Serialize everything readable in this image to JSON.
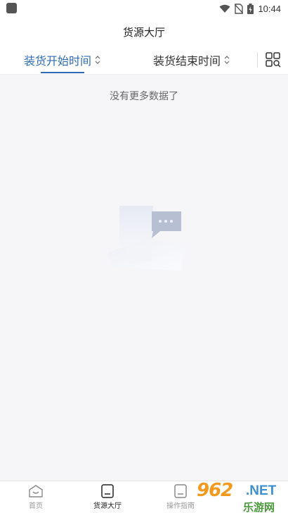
{
  "status_bar": {
    "time": "10:44",
    "icons": [
      "wifi-icon",
      "no-sim-icon",
      "battery-icon"
    ]
  },
  "header": {
    "title": "货源大厅"
  },
  "filters": {
    "tabs": [
      {
        "label": "装货开始时间",
        "active": true,
        "icon": "sort-icon"
      },
      {
        "label": "装货结束时间",
        "active": false,
        "icon": "sort-icon"
      }
    ],
    "layout_icon": "grid-search-icon"
  },
  "content": {
    "empty_message": "没有更多数据了",
    "illustration": "empty-message-icon"
  },
  "bottom_nav": {
    "items": [
      {
        "label": "首页",
        "icon": "home-icon",
        "active": false
      },
      {
        "label": "货源大厅",
        "icon": "document-icon",
        "active": true
      },
      {
        "label": "操作指南",
        "icon": "guide-icon",
        "active": false
      }
    ]
  },
  "watermark": {
    "digits": "962",
    "suffix": ".NET",
    "subtitle": "乐游网"
  },
  "colors": {
    "accent": "#2f6cb4",
    "background": "#f6f6f8",
    "watermark_orange": "#f39a1e",
    "watermark_blue": "#3d8fd1",
    "watermark_green": "#4a9a3c"
  }
}
